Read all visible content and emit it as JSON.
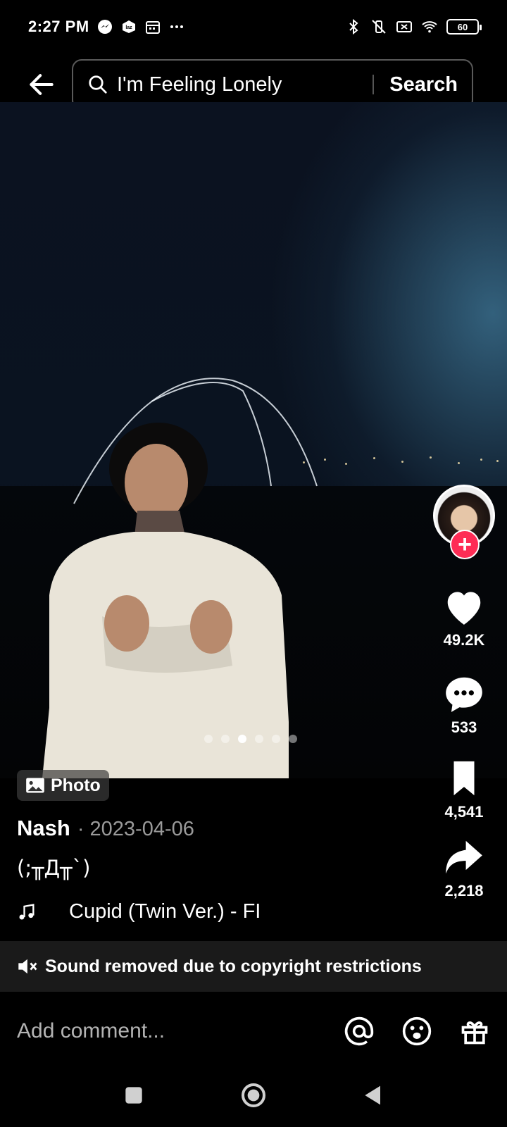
{
  "status_bar": {
    "time": "2:27 PM",
    "battery": "60"
  },
  "search": {
    "query": "I'm Feeling Lonely",
    "button_label": "Search"
  },
  "carousel": {
    "count": 6,
    "active_index": 2
  },
  "actions": {
    "likes": "49.2K",
    "comments": "533",
    "bookmarks": "4,541",
    "shares": "2,218"
  },
  "post": {
    "type_label": "Photo",
    "author": "Nash",
    "date": "· 2023-04-06",
    "caption": "(;╥Д╥`)",
    "music": "Cupid (Twin Ver.) - FI"
  },
  "notice": {
    "sound_removed": "Sound removed due to copyright restrictions"
  },
  "comment": {
    "placeholder": "Add comment..."
  },
  "colors": {
    "follow": "#fe2c55",
    "background": "#000000"
  }
}
